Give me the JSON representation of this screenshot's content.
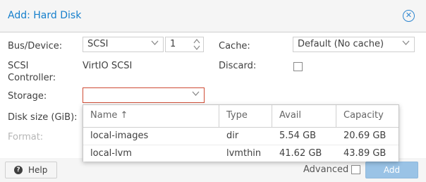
{
  "dialog": {
    "title": "Add: Hard Disk",
    "close_icon": "close-icon"
  },
  "form": {
    "bus_device": {
      "label": "Bus/Device:",
      "bus_value": "SCSI",
      "device_value": "1"
    },
    "scsi_controller": {
      "label_line1": "SCSI",
      "label_line2": "Controller:",
      "value": "VirtIO SCSI"
    },
    "storage": {
      "label": "Storage:",
      "value": ""
    },
    "disk_size": {
      "label": "Disk size (GiB):"
    },
    "format": {
      "label": "Format:"
    },
    "cache": {
      "label": "Cache:",
      "value": "Default (No cache)"
    },
    "discard": {
      "label": "Discard:",
      "checked": false
    }
  },
  "storage_dropdown": {
    "columns": [
      "Name ↑",
      "Type",
      "Avail",
      "Capacity"
    ],
    "rows": [
      {
        "name": "local-images",
        "type": "dir",
        "avail": "5.54 GB",
        "capacity": "20.69 GB"
      },
      {
        "name": "local-lvm",
        "type": "lvmthin",
        "avail": "41.62 GB",
        "capacity": "43.89 GB"
      }
    ]
  },
  "footer": {
    "help_label": "Help",
    "advanced_label": "Advanced",
    "add_label": "Add"
  },
  "colors": {
    "accent": "#157fcc",
    "invalid_border": "#cf4c35",
    "add_button_disabled": "#9ac3e6"
  }
}
